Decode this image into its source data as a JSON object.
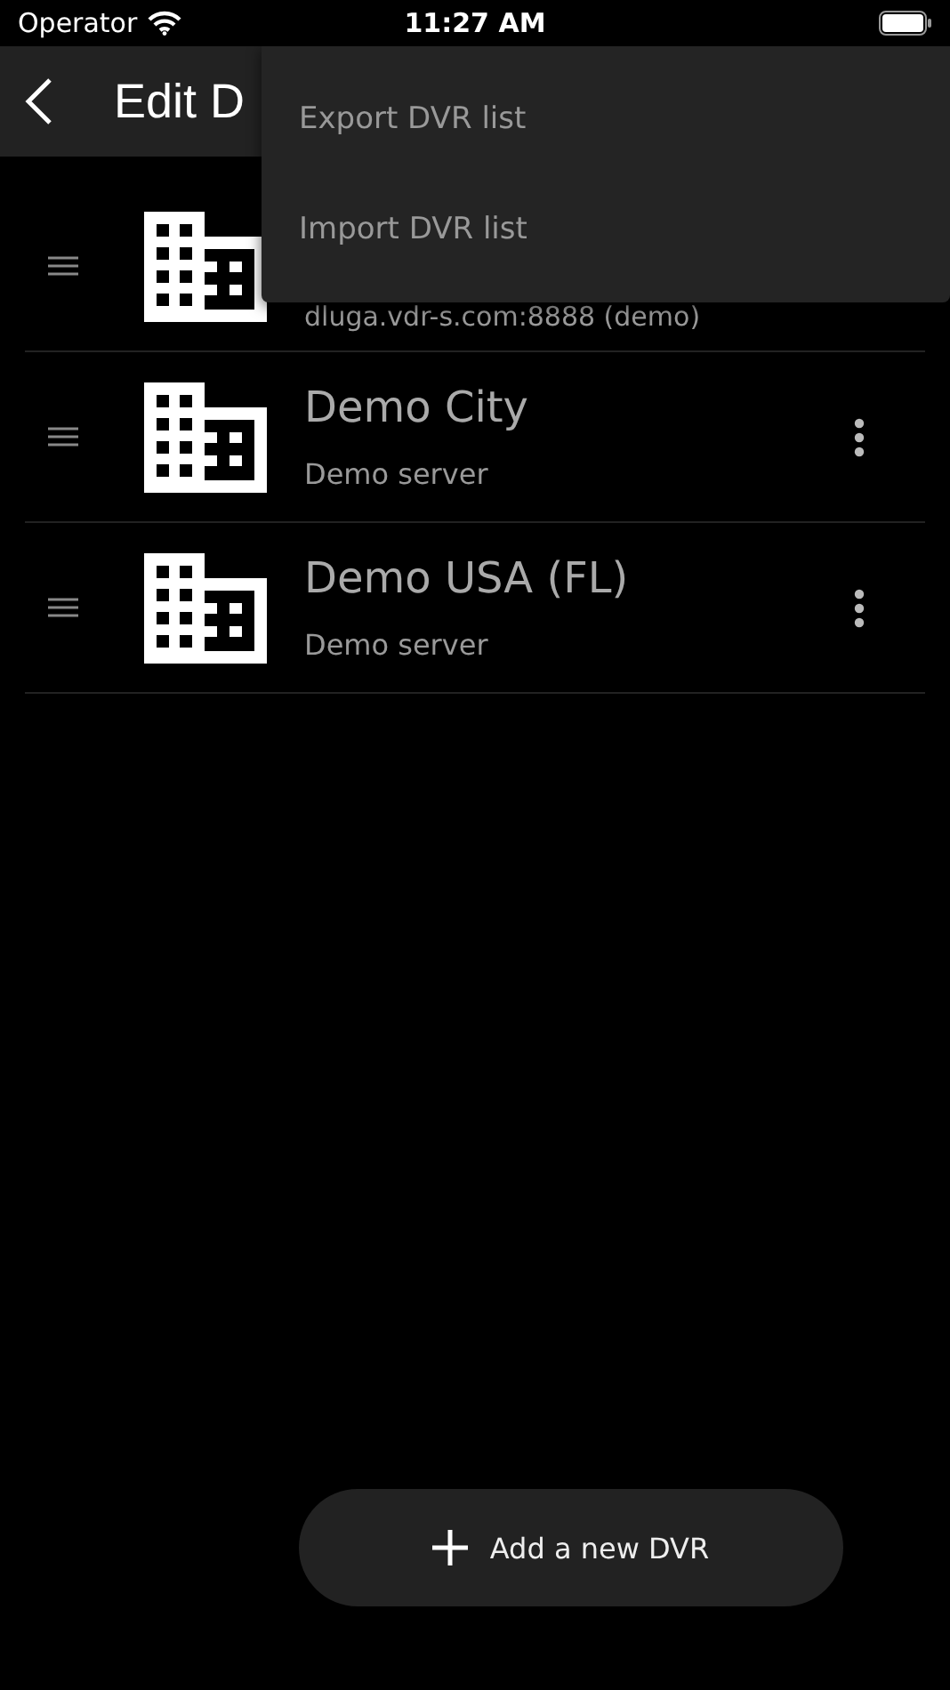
{
  "status_bar": {
    "carrier": "Operator",
    "time": "11:27 AM"
  },
  "header": {
    "title": "Edit D"
  },
  "menu": {
    "items": [
      {
        "label": "Export DVR list"
      },
      {
        "label": "Import DVR list"
      }
    ]
  },
  "servers": [
    {
      "subtitle": "dluga.vdr-s.com:8888 (demo)",
      "covered": true
    },
    {
      "title": "Demo City",
      "subtitle": "Demo server",
      "covered": false
    },
    {
      "title": "Demo USA (FL)",
      "subtitle": "Demo server",
      "covered": false
    }
  ],
  "add_button": {
    "label": "Add a new DVR"
  }
}
